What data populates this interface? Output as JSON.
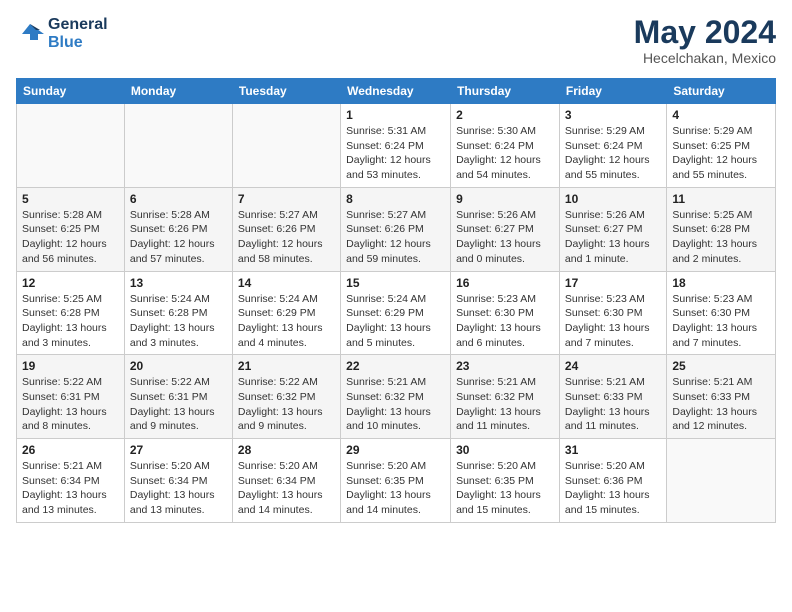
{
  "header": {
    "logo_line1": "General",
    "logo_line2": "Blue",
    "month_year": "May 2024",
    "location": "Hecelchakan, Mexico"
  },
  "weekdays": [
    "Sunday",
    "Monday",
    "Tuesday",
    "Wednesday",
    "Thursday",
    "Friday",
    "Saturday"
  ],
  "weeks": [
    [
      {
        "day": "",
        "info": ""
      },
      {
        "day": "",
        "info": ""
      },
      {
        "day": "",
        "info": ""
      },
      {
        "day": "1",
        "info": "Sunrise: 5:31 AM\nSunset: 6:24 PM\nDaylight: 12 hours\nand 53 minutes."
      },
      {
        "day": "2",
        "info": "Sunrise: 5:30 AM\nSunset: 6:24 PM\nDaylight: 12 hours\nand 54 minutes."
      },
      {
        "day": "3",
        "info": "Sunrise: 5:29 AM\nSunset: 6:24 PM\nDaylight: 12 hours\nand 55 minutes."
      },
      {
        "day": "4",
        "info": "Sunrise: 5:29 AM\nSunset: 6:25 PM\nDaylight: 12 hours\nand 55 minutes."
      }
    ],
    [
      {
        "day": "5",
        "info": "Sunrise: 5:28 AM\nSunset: 6:25 PM\nDaylight: 12 hours\nand 56 minutes."
      },
      {
        "day": "6",
        "info": "Sunrise: 5:28 AM\nSunset: 6:26 PM\nDaylight: 12 hours\nand 57 minutes."
      },
      {
        "day": "7",
        "info": "Sunrise: 5:27 AM\nSunset: 6:26 PM\nDaylight: 12 hours\nand 58 minutes."
      },
      {
        "day": "8",
        "info": "Sunrise: 5:27 AM\nSunset: 6:26 PM\nDaylight: 12 hours\nand 59 minutes."
      },
      {
        "day": "9",
        "info": "Sunrise: 5:26 AM\nSunset: 6:27 PM\nDaylight: 13 hours\nand 0 minutes."
      },
      {
        "day": "10",
        "info": "Sunrise: 5:26 AM\nSunset: 6:27 PM\nDaylight: 13 hours\nand 1 minute."
      },
      {
        "day": "11",
        "info": "Sunrise: 5:25 AM\nSunset: 6:28 PM\nDaylight: 13 hours\nand 2 minutes."
      }
    ],
    [
      {
        "day": "12",
        "info": "Sunrise: 5:25 AM\nSunset: 6:28 PM\nDaylight: 13 hours\nand 3 minutes."
      },
      {
        "day": "13",
        "info": "Sunrise: 5:24 AM\nSunset: 6:28 PM\nDaylight: 13 hours\nand 3 minutes."
      },
      {
        "day": "14",
        "info": "Sunrise: 5:24 AM\nSunset: 6:29 PM\nDaylight: 13 hours\nand 4 minutes."
      },
      {
        "day": "15",
        "info": "Sunrise: 5:24 AM\nSunset: 6:29 PM\nDaylight: 13 hours\nand 5 minutes."
      },
      {
        "day": "16",
        "info": "Sunrise: 5:23 AM\nSunset: 6:30 PM\nDaylight: 13 hours\nand 6 minutes."
      },
      {
        "day": "17",
        "info": "Sunrise: 5:23 AM\nSunset: 6:30 PM\nDaylight: 13 hours\nand 7 minutes."
      },
      {
        "day": "18",
        "info": "Sunrise: 5:23 AM\nSunset: 6:30 PM\nDaylight: 13 hours\nand 7 minutes."
      }
    ],
    [
      {
        "day": "19",
        "info": "Sunrise: 5:22 AM\nSunset: 6:31 PM\nDaylight: 13 hours\nand 8 minutes."
      },
      {
        "day": "20",
        "info": "Sunrise: 5:22 AM\nSunset: 6:31 PM\nDaylight: 13 hours\nand 9 minutes."
      },
      {
        "day": "21",
        "info": "Sunrise: 5:22 AM\nSunset: 6:32 PM\nDaylight: 13 hours\nand 9 minutes."
      },
      {
        "day": "22",
        "info": "Sunrise: 5:21 AM\nSunset: 6:32 PM\nDaylight: 13 hours\nand 10 minutes."
      },
      {
        "day": "23",
        "info": "Sunrise: 5:21 AM\nSunset: 6:32 PM\nDaylight: 13 hours\nand 11 minutes."
      },
      {
        "day": "24",
        "info": "Sunrise: 5:21 AM\nSunset: 6:33 PM\nDaylight: 13 hours\nand 11 minutes."
      },
      {
        "day": "25",
        "info": "Sunrise: 5:21 AM\nSunset: 6:33 PM\nDaylight: 13 hours\nand 12 minutes."
      }
    ],
    [
      {
        "day": "26",
        "info": "Sunrise: 5:21 AM\nSunset: 6:34 PM\nDaylight: 13 hours\nand 13 minutes."
      },
      {
        "day": "27",
        "info": "Sunrise: 5:20 AM\nSunset: 6:34 PM\nDaylight: 13 hours\nand 13 minutes."
      },
      {
        "day": "28",
        "info": "Sunrise: 5:20 AM\nSunset: 6:34 PM\nDaylight: 13 hours\nand 14 minutes."
      },
      {
        "day": "29",
        "info": "Sunrise: 5:20 AM\nSunset: 6:35 PM\nDaylight: 13 hours\nand 14 minutes."
      },
      {
        "day": "30",
        "info": "Sunrise: 5:20 AM\nSunset: 6:35 PM\nDaylight: 13 hours\nand 15 minutes."
      },
      {
        "day": "31",
        "info": "Sunrise: 5:20 AM\nSunset: 6:36 PM\nDaylight: 13 hours\nand 15 minutes."
      },
      {
        "day": "",
        "info": ""
      }
    ]
  ]
}
